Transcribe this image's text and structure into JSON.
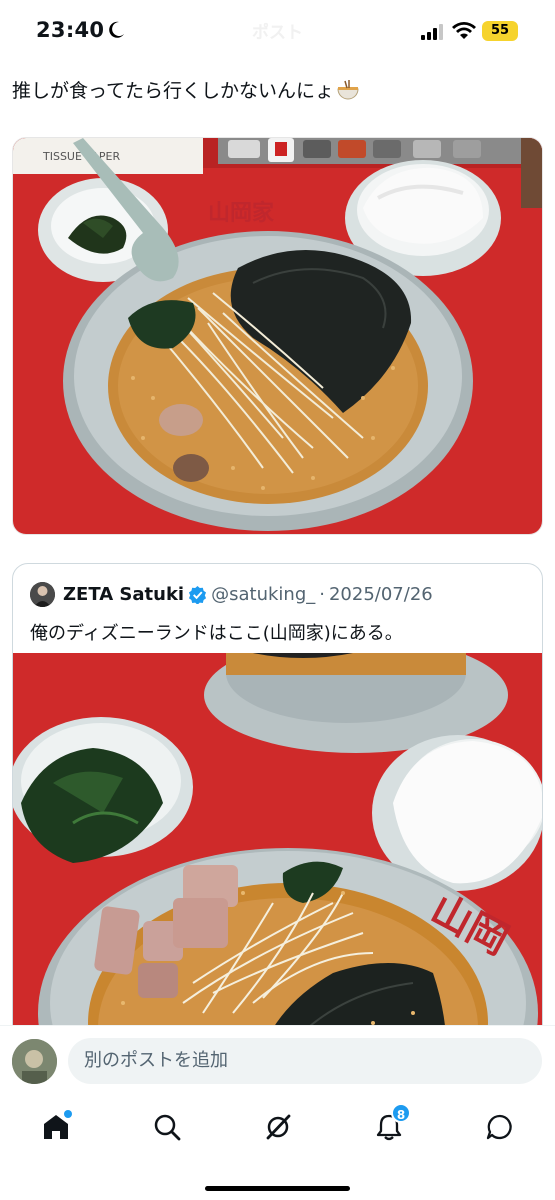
{
  "status_bar": {
    "time": "23:40",
    "header_title": "ポスト",
    "battery": "55"
  },
  "post": {
    "text": "推しが食ってたら行くしかないんにょ",
    "emoji_icon": "ramen-bowl-emoji"
  },
  "quote": {
    "display_name": "ZETA Satuki",
    "handle": "@satuking_",
    "separator": "·",
    "date": "2025/07/26",
    "text": "俺のディズニーランドはここ(山岡家)にある。"
  },
  "compose": {
    "placeholder": "別のポストを追加"
  },
  "tabbar": {
    "notification_count": "8",
    "items": [
      "home-icon",
      "search-icon",
      "grok-icon",
      "bell-icon",
      "message-icon"
    ]
  },
  "colors": {
    "accent": "#1d9bf0",
    "table_red": "#d42a2a",
    "bowl": "#bfc8c9",
    "broth": "#c98a3a"
  }
}
